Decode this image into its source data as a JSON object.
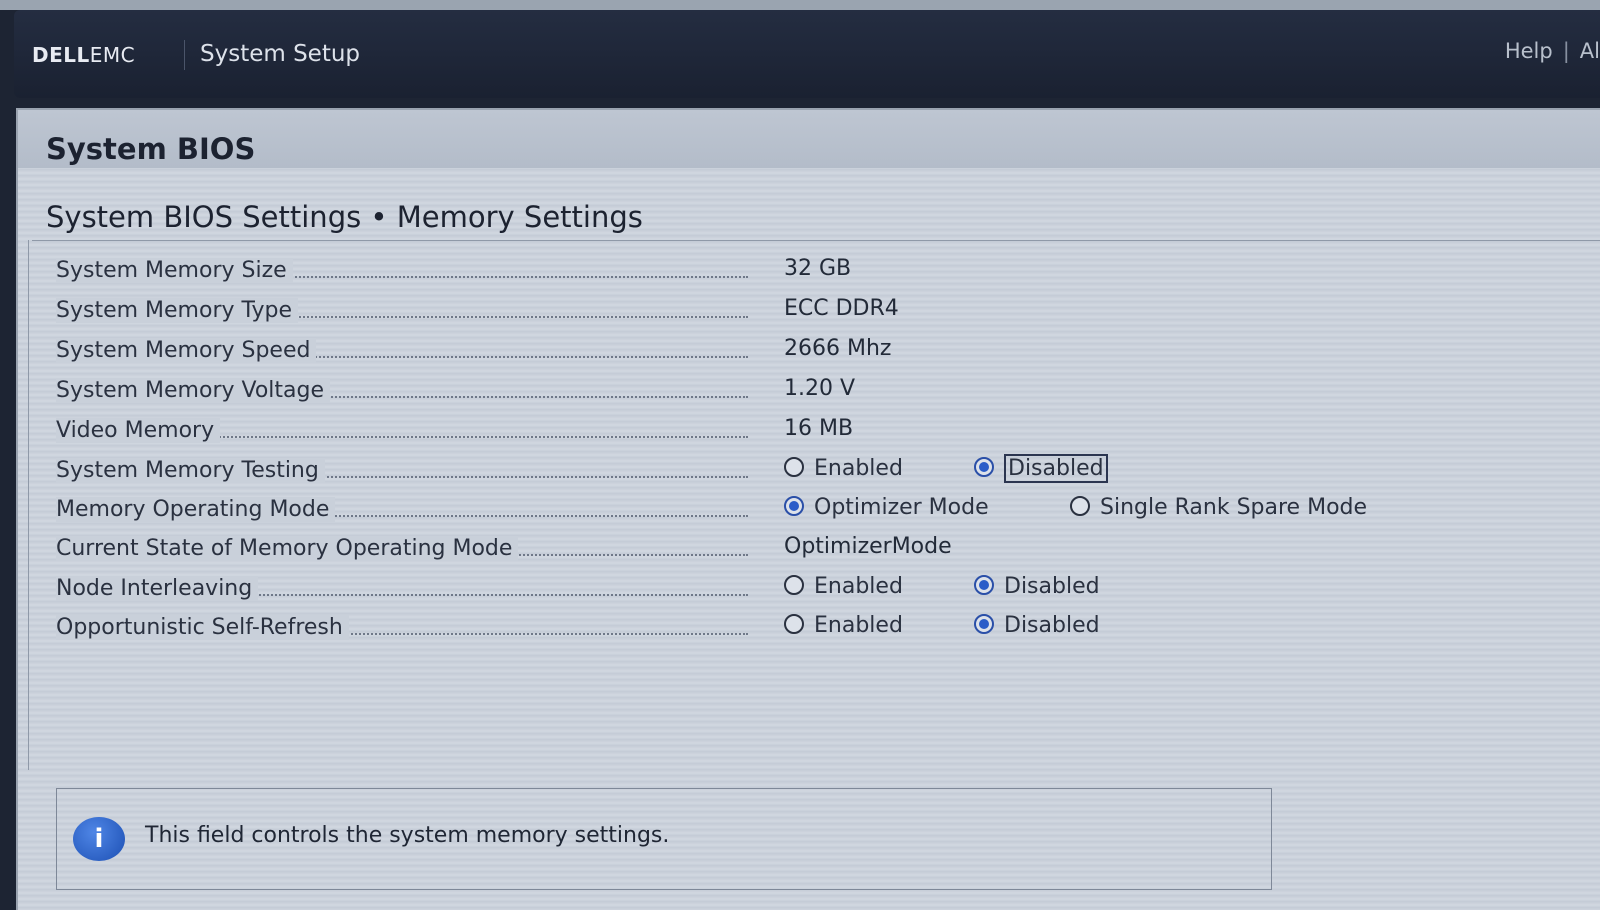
{
  "header": {
    "brand_dell": "DELL",
    "brand_emc": "EMC",
    "title": "System Setup",
    "links": [
      "Help",
      "|",
      "Al"
    ]
  },
  "panel": {
    "title": "System BIOS",
    "breadcrumb": "System BIOS Settings • Memory Settings"
  },
  "settings": [
    {
      "label": "System Memory Size",
      "value": "32 GB"
    },
    {
      "label": "System Memory Type",
      "value": "ECC DDR4"
    },
    {
      "label": "System Memory Speed",
      "value": "2666 Mhz"
    },
    {
      "label": "System Memory Voltage",
      "value": "1.20 V"
    },
    {
      "label": "Video Memory",
      "value": "16 MB"
    },
    {
      "label": "System Memory Testing",
      "options": [
        "Enabled",
        "Disabled"
      ],
      "selected": "Disabled"
    },
    {
      "label": "Memory Operating Mode",
      "options": [
        "Optimizer Mode",
        "Single Rank Spare Mode"
      ],
      "selected": "Optimizer Mode"
    },
    {
      "label": "Current State of Memory Operating Mode",
      "value": "OptimizerMode"
    },
    {
      "label": "Node Interleaving",
      "options": [
        "Enabled",
        "Disabled"
      ],
      "selected": "Disabled"
    },
    {
      "label": "Opportunistic Self-Refresh",
      "options": [
        "Enabled",
        "Disabled"
      ],
      "selected": "Disabled"
    }
  ],
  "info": {
    "icon": "info-icon",
    "icon_glyph": "i",
    "text": "This field controls the system memory settings."
  },
  "colors": {
    "header_bg": "#1d2433",
    "panel_bg": "#c9d0da",
    "radio_selected": "#2a5cc8"
  }
}
